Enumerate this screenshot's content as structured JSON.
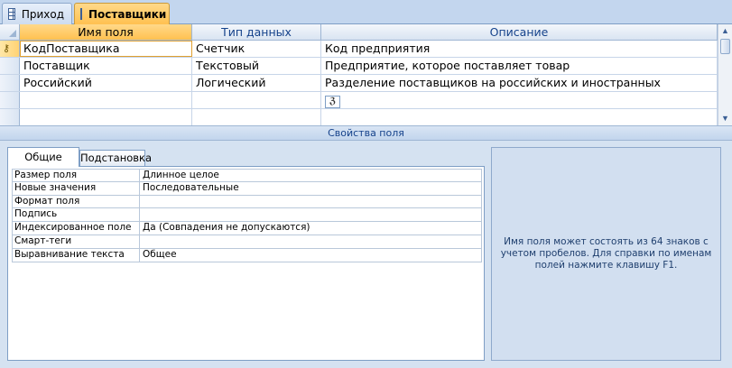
{
  "tabs": [
    {
      "label": "Приход",
      "active": false
    },
    {
      "label": "Поставщики",
      "active": true
    }
  ],
  "grid": {
    "headers": [
      "Имя поля",
      "Тип данных",
      "Описание"
    ],
    "rows": [
      {
        "name": "КодПоставщика",
        "type": "Счетчик",
        "description": "Код предприятия",
        "key": true
      },
      {
        "name": "Поставщик",
        "type": "Текстовый",
        "description": "Предприятие, которое поставляет товар",
        "key": false
      },
      {
        "name": "Российский",
        "type": "Логический",
        "description": "Разделение поставщиков на российских и иностранных",
        "key": false
      },
      {
        "name": "",
        "type": "",
        "description": "",
        "key": false
      },
      {
        "name": "",
        "type": "",
        "description": "",
        "key": false
      }
    ]
  },
  "properties": {
    "section_title": "Свойства поля",
    "tabs": [
      "Общие",
      "Подстановка"
    ],
    "rows": [
      {
        "label": "Размер поля",
        "value": "Длинное целое"
      },
      {
        "label": "Новые значения",
        "value": "Последовательные"
      },
      {
        "label": "Формат поля",
        "value": ""
      },
      {
        "label": "Подпись",
        "value": ""
      },
      {
        "label": "Индексированное поле",
        "value": "Да (Совпадения не допускаются)"
      },
      {
        "label": "Смарт-теги",
        "value": ""
      },
      {
        "label": "Выравнивание текста",
        "value": "Общее"
      }
    ],
    "help_text": "Имя поля может состоять из 64 знаков с учетом пробелов.  Для справки по именам полей нажмите клавишу F1."
  },
  "icons": {
    "table_tab": "table-icon",
    "primary_key": "primary-key-icon",
    "builder": "builder-icon",
    "scroll_up": "arrow-up-icon",
    "scroll_down": "arrow-down-icon"
  },
  "colors": {
    "active_tab": "#ffc150",
    "header_text": "#15428b",
    "panel_bg": "#d5e2f1"
  }
}
